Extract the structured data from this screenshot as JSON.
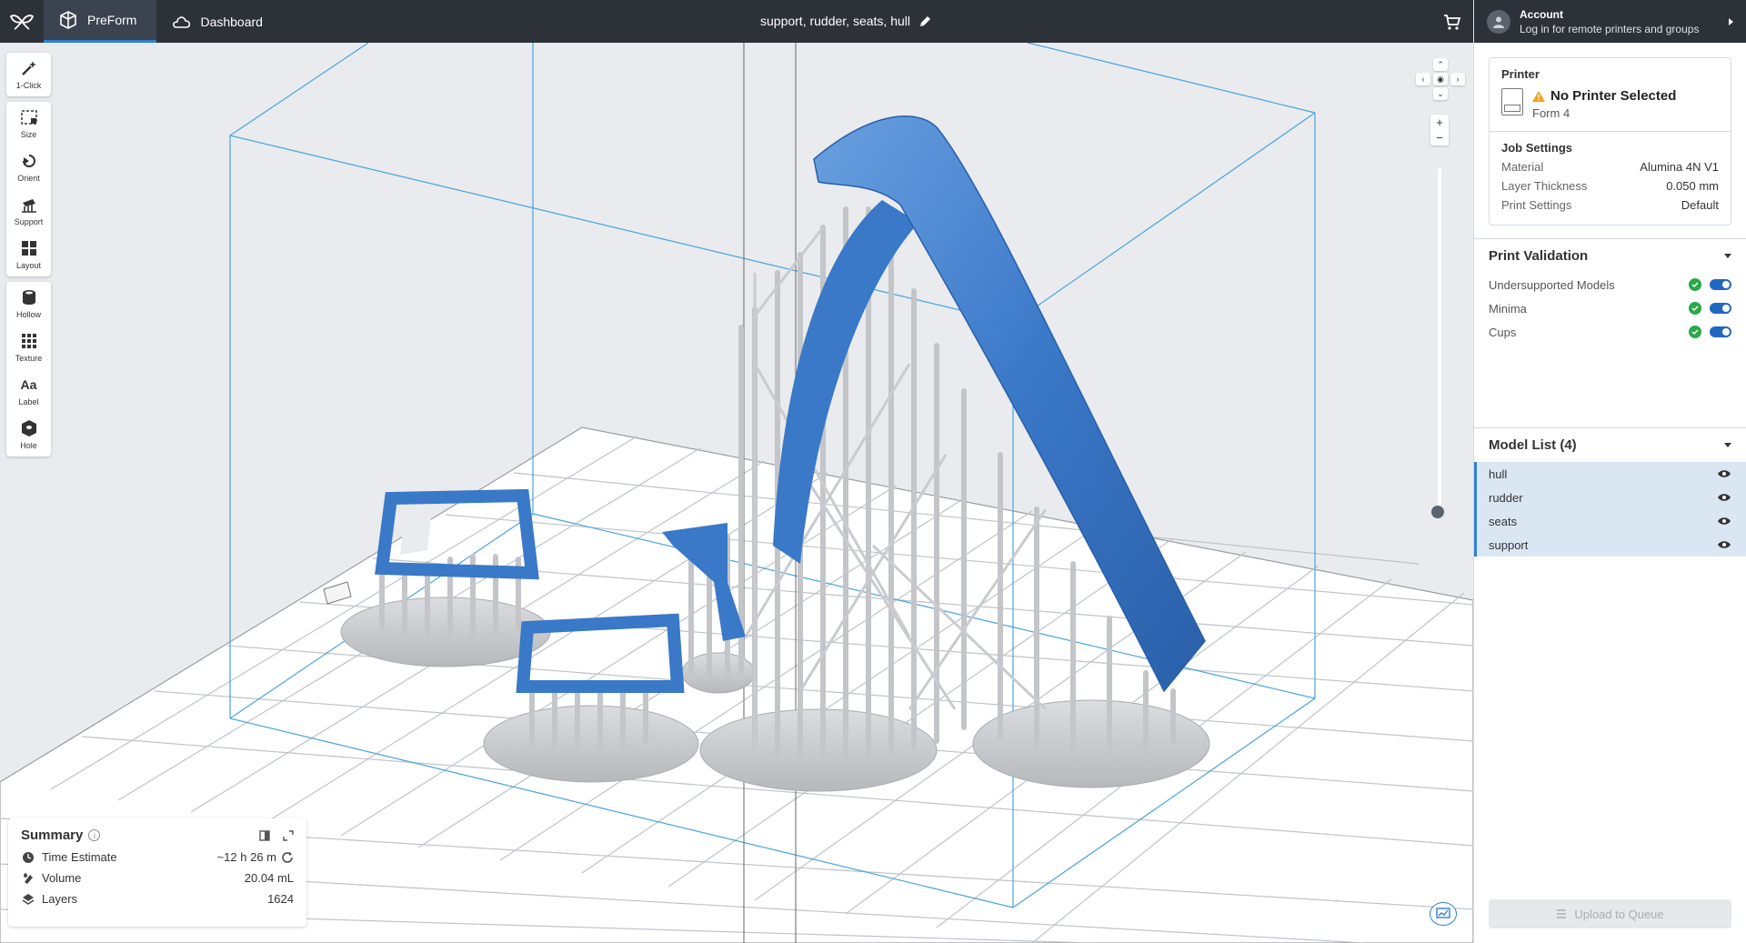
{
  "app": {
    "tabs": [
      {
        "label": "PreForm",
        "icon": "preform-cube-icon",
        "active": true
      },
      {
        "label": "Dashboard",
        "icon": "cloud-icon",
        "active": false
      }
    ],
    "job_title": "support, rudder, seats, hull"
  },
  "account": {
    "title": "Account",
    "subtitle": "Log in for remote printers and groups"
  },
  "printer": {
    "label": "Printer",
    "name": "No Printer Selected",
    "model": "Form 4"
  },
  "job_settings": {
    "title": "Job Settings",
    "rows": [
      {
        "key": "Material",
        "value": "Alumina 4N V1"
      },
      {
        "key": "Layer Thickness",
        "value": "0.050 mm"
      },
      {
        "key": "Print Settings",
        "value": "Default"
      }
    ]
  },
  "print_validation": {
    "title": "Print Validation",
    "items": [
      {
        "label": "Undersupported Models",
        "enabled": true
      },
      {
        "label": "Minima",
        "enabled": true
      },
      {
        "label": "Cups",
        "enabled": true
      }
    ]
  },
  "model_list": {
    "title": "Model List (4)",
    "items": [
      "hull",
      "rudder",
      "seats",
      "support"
    ]
  },
  "upload_button": "Upload to Queue",
  "toolbar": {
    "groups": [
      [
        {
          "label": "1-Click",
          "icon": "magic-wand-icon"
        }
      ],
      [
        {
          "label": "Size",
          "icon": "size-icon"
        },
        {
          "label": "Orient",
          "icon": "orient-icon"
        },
        {
          "label": "Support",
          "icon": "support-icon"
        },
        {
          "label": "Layout",
          "icon": "layout-icon"
        }
      ],
      [
        {
          "label": "Hollow",
          "icon": "hollow-icon"
        },
        {
          "label": "Texture",
          "icon": "texture-icon"
        },
        {
          "label": "Label",
          "icon": "label-icon"
        },
        {
          "label": "Hole",
          "icon": "hole-icon"
        }
      ]
    ]
  },
  "summary": {
    "title": "Summary",
    "rows": [
      {
        "label": "Time Estimate",
        "value": "~12 h 26 m",
        "icon": "clock-icon"
      },
      {
        "label": "Volume",
        "value": "20.04 mL",
        "icon": "resin-drop-icon"
      },
      {
        "label": "Layers",
        "value": "1624",
        "icon": "layers-icon"
      }
    ]
  },
  "layer_slider": {
    "position": 0.0
  },
  "colors": {
    "topbar": "#2d3138",
    "accent": "#2f7fd6",
    "model_blue": "#3a78c8",
    "support_gray": "#c9cacd",
    "check_green": "#2aa84a"
  }
}
